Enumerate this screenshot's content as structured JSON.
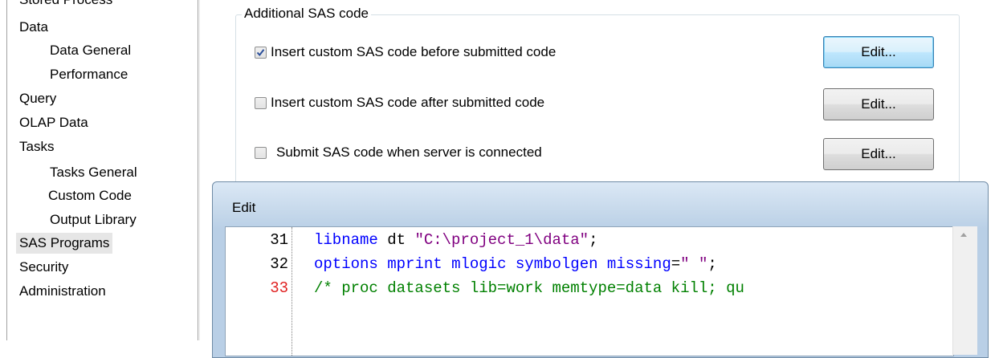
{
  "nav": {
    "clipped_item": "Stored Process",
    "items": [
      {
        "label": "Data",
        "indent": 0
      },
      {
        "label": "Data General",
        "indent": 1
      },
      {
        "label": "Performance",
        "indent": 1
      },
      {
        "label": "Query",
        "indent": 0
      },
      {
        "label": "OLAP Data",
        "indent": 0
      },
      {
        "label": "Tasks",
        "indent": 0
      },
      {
        "label": "Tasks General",
        "indent": 1
      },
      {
        "label": "Custom Code",
        "indent": 1
      },
      {
        "label": "Output Library",
        "indent": 1
      },
      {
        "label": "SAS Programs",
        "indent": 0,
        "selected": true
      },
      {
        "label": "Security",
        "indent": 0
      },
      {
        "label": "Administration",
        "indent": 0
      }
    ]
  },
  "group": {
    "legend": "Additional SAS code",
    "options": [
      {
        "label": "Insert custom SAS code before submitted code",
        "checked": true,
        "button": "Edit..."
      },
      {
        "label": "Insert custom SAS code after submitted code",
        "checked": false,
        "button": "Edit..."
      },
      {
        "label": "Submit SAS code when server is connected",
        "checked": false,
        "button": "Edit..."
      }
    ]
  },
  "edit_window": {
    "title": "Edit",
    "lines": [
      {
        "number": "31",
        "segments": [
          [
            "kw",
            "libname"
          ],
          [
            "plain",
            " dt "
          ],
          [
            "str",
            "\"C:\\project_1\\data\""
          ],
          [
            "plain",
            ";"
          ]
        ]
      },
      {
        "number": "32",
        "segments": [
          [
            "kw",
            "options"
          ],
          [
            "plain",
            " "
          ],
          [
            "kw",
            "mprint"
          ],
          [
            "plain",
            " "
          ],
          [
            "kw",
            "mlogic"
          ],
          [
            "plain",
            " "
          ],
          [
            "kw",
            "symbolgen"
          ],
          [
            "plain",
            " "
          ],
          [
            "kw",
            "missing"
          ],
          [
            "plain",
            "="
          ],
          [
            "str",
            "\" \""
          ],
          [
            "plain",
            ";"
          ]
        ]
      },
      {
        "number": "33",
        "highlight": true,
        "segments": [
          [
            "cmt",
            "/* proc datasets lib=work memtype=data kill; qu"
          ]
        ]
      }
    ]
  },
  "colors": {
    "keyword": "#0000ff",
    "string": "#800080",
    "comment": "#008000",
    "current_line_number": "#e02020",
    "selection_bg": "#e6e6e6"
  }
}
